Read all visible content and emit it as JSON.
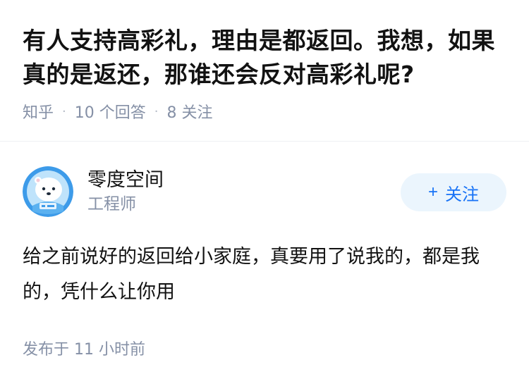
{
  "question": {
    "title": "有人支持高彩礼，理由是都返回。我想，如果真的是返还，那谁还会反对高彩礼呢?",
    "source": "知乎",
    "answers_count_label": "10 个回答",
    "followers_count_label": "8 关注"
  },
  "answer": {
    "author": {
      "name": "零度空间",
      "title": "工程师",
      "avatar_icon": "polar-bear-astronaut-icon"
    },
    "follow_button": {
      "plus": "+",
      "label": "关注"
    },
    "content": "给之前说好的返回给小家庭，真要用了说我的，都是我的，凭什么让你用",
    "published": "发布于 11 小时前"
  },
  "colors": {
    "primary_text": "#121212",
    "secondary_text": "#8590a6",
    "accent": "#1772f6",
    "follow_bg": "#ebf5fd"
  }
}
